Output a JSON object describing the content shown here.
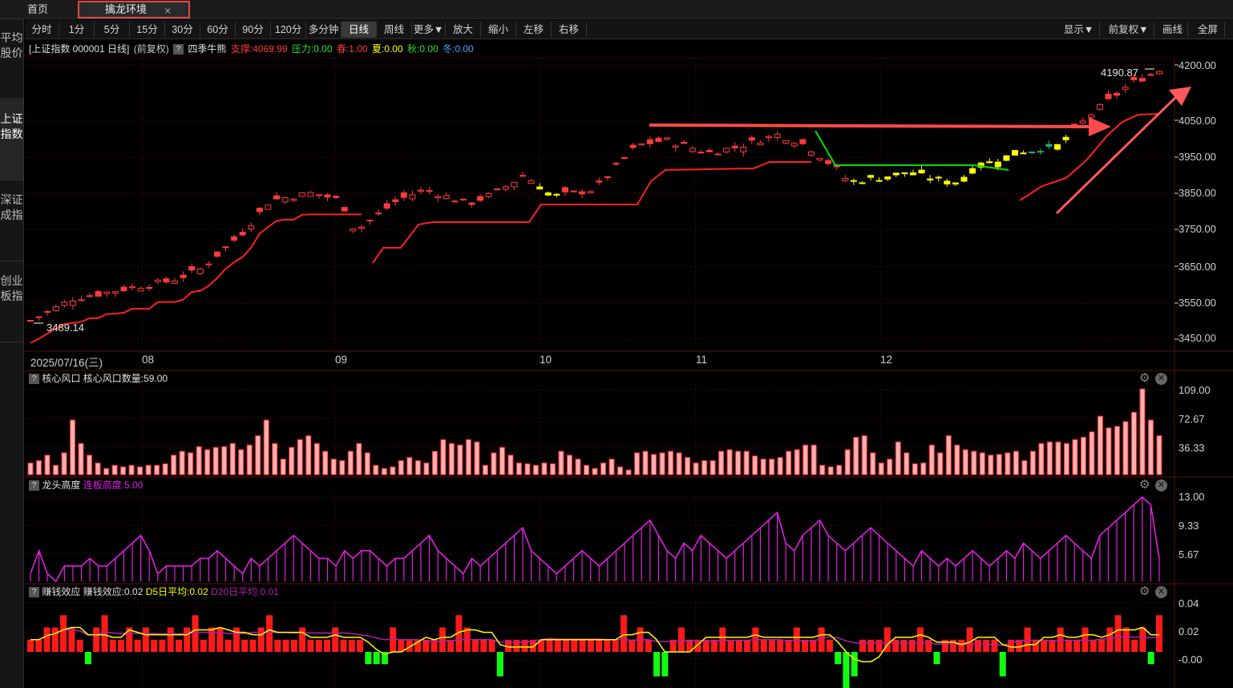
{
  "tabs": {
    "home": "首页",
    "active": "擒龙环境",
    "close": "×"
  },
  "sidenav": [
    {
      "label": "平均股价"
    },
    {
      "label": "上证指数",
      "active": true
    },
    {
      "label": "深证成指"
    },
    {
      "label": "创业板指"
    }
  ],
  "toolbar": {
    "left": [
      "分时",
      "1分",
      "5分",
      "15分",
      "30分",
      "60分",
      "90分",
      "120分",
      "多分钟",
      "日线",
      "周线",
      "更多▼",
      "放大",
      "缩小",
      "左移",
      "右移"
    ],
    "active": "日线",
    "right": [
      "显示▼",
      "前复权▼",
      "画线",
      "全屏"
    ]
  },
  "info": {
    "title": "[上证指数 000001 日线]",
    "adjust": "(前复权)",
    "q": "?",
    "indicator": "四季牛熊",
    "support": "支撑:4069.99",
    "pressure": "压力:0.00",
    "spring": "春:1.00",
    "summer": "夏:0.00",
    "autumn": "秋:0.00",
    "winter": "冬:0.00"
  },
  "colors": {
    "up": "#ff3b3b",
    "down": "#00e5e5",
    "yellow": "#ffff00",
    "green": "#00e000",
    "teal": "#2ab07a",
    "purple": "#e020e0",
    "axis": "#d0d0d0"
  },
  "main_chart": {
    "type": "candlestick",
    "y_ticks": [
      "4200.00",
      "4050.00",
      "3950.00",
      "3850.00",
      "3750.00",
      "3650.00",
      "3550.00",
      "3450.00"
    ],
    "x_labels": [
      "2025/07/16(三)",
      "08",
      "09",
      "10",
      "11",
      "12"
    ],
    "high_label": "4190.87",
    "low_label": "3489.14"
  },
  "panel1": {
    "q": "?",
    "name": "核心风口",
    "value": "核心风口数量:59.00",
    "y_ticks": [
      "109.00",
      "72.67",
      "36.33"
    ]
  },
  "panel2": {
    "q": "?",
    "name": "龙头高度",
    "value": "连板高度:5.00",
    "y_ticks": [
      "13.00",
      "9.33",
      "5.67"
    ]
  },
  "panel3": {
    "q": "?",
    "name": "赚钱效应",
    "value": "赚钱效应:0.02",
    "d5": "D5日平均:0.02",
    "d20": "D20日平均:0.01",
    "y_ticks": [
      "0.04",
      "0.02",
      "-0.00"
    ]
  },
  "chart_data": {
    "type": "bar",
    "panels": [
      {
        "name": "核心风口数量",
        "values": [
          15,
          18,
          25,
          12,
          28,
          70,
          40,
          25,
          15,
          8,
          12,
          10,
          12,
          10,
          12,
          12,
          14,
          25,
          30,
          28,
          36,
          32,
          35,
          36,
          40,
          32,
          38,
          50,
          70,
          40,
          20,
          35,
          45,
          50,
          40,
          30,
          20,
          18,
          30,
          40,
          28,
          12,
          8,
          10,
          18,
          22,
          18,
          15,
          30,
          45,
          40,
          38,
          45,
          42,
          12,
          28,
          35,
          25,
          15,
          14,
          12,
          15,
          14,
          30,
          25,
          20,
          12,
          8,
          15,
          20,
          10,
          6,
          28,
          30,
          26,
          28,
          30,
          28,
          22,
          15,
          18,
          18,
          30,
          32,
          30,
          30,
          24,
          20,
          20,
          22,
          30,
          32,
          38,
          38,
          12,
          10,
          12,
          32,
          48,
          50,
          28,
          15,
          20,
          42,
          28,
          14,
          15,
          38,
          28,
          50,
          38,
          32,
          30,
          28,
          25,
          26,
          28,
          30,
          18,
          30,
          40,
          42,
          42,
          40,
          45,
          48,
          55,
          75,
          60,
          62,
          68,
          80,
          110,
          70,
          50
        ]
      },
      {
        "name": "连板高度",
        "values": [
          3,
          6,
          3,
          2,
          4,
          4,
          4,
          5,
          4,
          4,
          5,
          6,
          7,
          8,
          6,
          3,
          4,
          4,
          4,
          4,
          5,
          5,
          6,
          5,
          4,
          3,
          5,
          4,
          5,
          6,
          7,
          8,
          7,
          6,
          5,
          5,
          4,
          6,
          5,
          6,
          6,
          5,
          4,
          5,
          5,
          6,
          7,
          8,
          6,
          5,
          4,
          3,
          5,
          4,
          5,
          6,
          7,
          8,
          9,
          6,
          5,
          4,
          3,
          4,
          5,
          6,
          5,
          4,
          5,
          6,
          7,
          8,
          9,
          10,
          8,
          6,
          5,
          7,
          6,
          8,
          7,
          6,
          5,
          6,
          7,
          8,
          9,
          10,
          11,
          7,
          6,
          8,
          9,
          10,
          8,
          7,
          6,
          7,
          8,
          9,
          8,
          7,
          6,
          5,
          4,
          6,
          5,
          4,
          5,
          4,
          5,
          6,
          5,
          4,
          5,
          6,
          5,
          7,
          6,
          5,
          6,
          7,
          8,
          7,
          6,
          5,
          8,
          9,
          10,
          11,
          12,
          13,
          12,
          5
        ]
      },
      {
        "name": "赚钱效应",
        "values": [
          0.01,
          0.01,
          0.02,
          0.02,
          0.03,
          0.02,
          0.01,
          -0.01,
          0.02,
          0.03,
          0.01,
          0.01,
          0.02,
          0.01,
          0.02,
          0.01,
          0.01,
          0.02,
          0.01,
          0.02,
          0.03,
          0.01,
          0.02,
          0.02,
          0.01,
          0.02,
          0.01,
          0.01,
          0.02,
          0.03,
          0.01,
          0.01,
          0.01,
          0.02,
          0.01,
          0.01,
          0.01,
          0.02,
          0.01,
          0.01,
          0.01,
          -0.01,
          -0.01,
          -0.01,
          0.02,
          0.01,
          0.01,
          0.01,
          0.01,
          0.01,
          0.02,
          0.01,
          0.03,
          0.02,
          0.01,
          0.01,
          0.01,
          -0.02,
          0.01,
          0.01,
          0.01,
          0.01,
          0.01,
          0.01,
          0.01,
          0.01,
          0.01,
          0.01,
          0.01,
          0.01,
          0.01,
          0.01,
          0.03,
          0.01,
          0.02,
          0.01,
          -0.02,
          -0.02,
          0.01,
          0.02,
          0.01,
          0.01,
          0.01,
          0.01,
          0.02,
          0.01,
          0.01,
          0.01,
          0.02,
          0.01,
          0.01,
          0.01,
          0.01,
          0.02,
          0.01,
          0.01,
          0.02,
          0.01,
          -0.01,
          -0.03,
          -0.02,
          0.01,
          0.01,
          0.01,
          0.02,
          0.01,
          0.01,
          0.01,
          0.02,
          0.01,
          -0.01,
          0.01,
          0.01,
          0.01,
          0.02,
          0.01,
          0.01,
          0.01,
          -0.02,
          0.01,
          0.01,
          0.02,
          0.01,
          0.01,
          0.01,
          0.02,
          0.01,
          0.01,
          0.02,
          0.01,
          0.01,
          0.02,
          0.03,
          0.02,
          0.01,
          0.02,
          -0.01,
          0.03
        ]
      }
    ]
  }
}
